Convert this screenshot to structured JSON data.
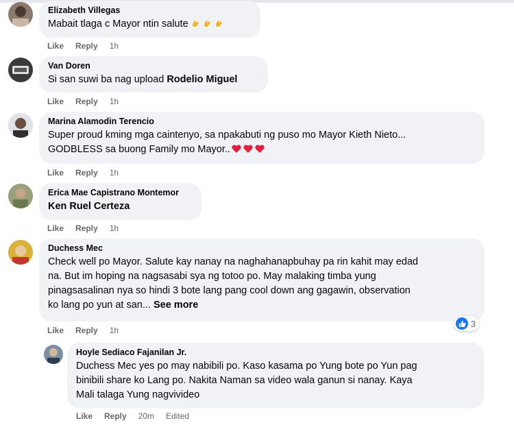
{
  "comments": [
    {
      "name": "Elizabeth Villegas",
      "text": "Mabait tlaga c Mayor ntin salute",
      "actions": {
        "like": "Like",
        "reply": "Reply",
        "time": "1h"
      }
    },
    {
      "name": "Van Doren",
      "text_prefix": "Si san suwi ba nag upload ",
      "mention": "Rodelio Miguel",
      "actions": {
        "like": "Like",
        "reply": "Reply",
        "time": "1h"
      }
    },
    {
      "name": "Marina Alamodin Terencio",
      "line1": "Super proud kming mga caintenyo, sa npakabuti ng puso mo Mayor Kieth Nieto...",
      "line2": "GODBLESS sa buong Family mo Mayor..",
      "actions": {
        "like": "Like",
        "reply": "Reply",
        "time": "1h"
      }
    },
    {
      "name": "Erica Mae Capistrano Montemor",
      "mention": "Ken Ruel Certeza",
      "actions": {
        "like": "Like",
        "reply": "Reply",
        "time": "1h"
      }
    },
    {
      "name": "Duchess Mec",
      "line1": "Check well po Mayor. Salute kay nanay na naghahanapbuhay pa rin kahit may edad",
      "line2": "na. But im hoping na nagsasabi sya ng totoo po. May malaking timba yung",
      "line3": "pinagsasalinan nya so hindi 3 bote lang pang cool down ang gagawin, observation",
      "line4": "ko lang po yun at san... ",
      "see_more": "See more",
      "reaction_count": "3",
      "actions": {
        "like": "Like",
        "reply": "Reply",
        "time": "1h"
      }
    },
    {
      "name": "Hoyle Sediaco Fajanilan Jr.",
      "line1": "Duchess Mec yes po may nabibili po. Kaso kasama po Yung bote po Yun pag",
      "line2": "binibili share ko Lang po. Nakita Naman sa video wala ganun si nanay. Kaya",
      "line3": "Mali talaga Yung nagvivideo",
      "actions": {
        "like": "Like",
        "reply": "Reply",
        "time": "20m",
        "edited": "Edited"
      }
    }
  ],
  "colors": {
    "bubble": "#f0f2f5",
    "meta": "#65676b",
    "like_blue": "#1877f2",
    "heart": "#e41e3f",
    "clap": "#f5b324"
  }
}
